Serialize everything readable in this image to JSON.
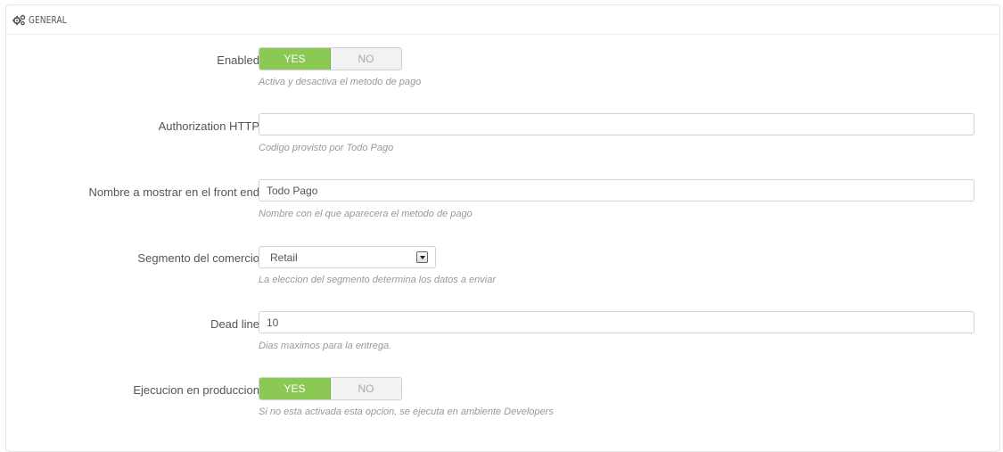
{
  "panel": {
    "title": "GENERAL",
    "icon": "cogs-icon"
  },
  "fields": {
    "enabled": {
      "label": "Enabled",
      "yes": "YES",
      "no": "NO",
      "value": "YES",
      "help": "Activa y desactiva el metodo de pago"
    },
    "authorization": {
      "label": "Authorization HTTP",
      "value": "",
      "help": "Codigo provisto por Todo Pago"
    },
    "display_name": {
      "label": "Nombre a mostrar en el front end",
      "value": "Todo Pago",
      "help": "Nombre con el que aparecera el metodo de pago"
    },
    "segment": {
      "label": "Segmento del comercio",
      "value": "Retail",
      "help": "La eleccion del segmento determina los datos a enviar"
    },
    "deadline": {
      "label": "Dead line",
      "value": "10",
      "help": "Dias maximos para la entrega."
    },
    "production": {
      "label": "Ejecucion en produccion",
      "yes": "YES",
      "no": "NO",
      "value": "YES",
      "help": "Si no esta activada esta opcion, se ejecuta en ambiente Developers"
    }
  },
  "colors": {
    "switch_on": "#8bc954",
    "help_text": "#999999",
    "label_text": "#555555",
    "input_border": "#c7d6db"
  }
}
